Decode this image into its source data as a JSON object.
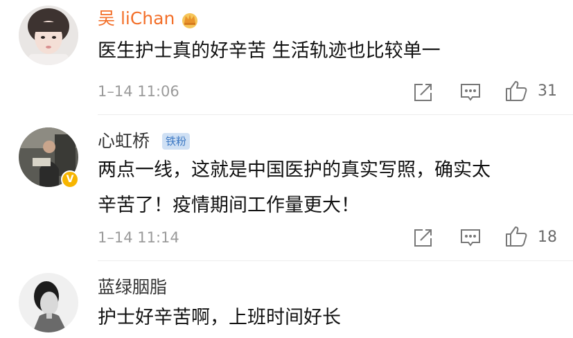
{
  "comments": [
    {
      "username": "吴 liChan",
      "text_lines": [
        "医生护士真的好辛苦 生活轨迹也比较单一"
      ],
      "time": "1–14 11:06",
      "likes": "31",
      "has_crown": true
    },
    {
      "username": "心虹桥",
      "badge": "铁粉",
      "verified_mark": "V",
      "text_lines": [
        "两点一线，这就是中国医护的真实写照，确实太",
        "辛苦了！疫情期间工作量更大！"
      ],
      "time": "1–14 11:14",
      "likes": "18"
    },
    {
      "username": "蓝绿胭脂",
      "text_lines": [
        "护士好辛苦啊，上班时间好长"
      ]
    }
  ],
  "icons": {
    "share": "share-icon",
    "reply": "comment-icon",
    "like": "thumbs-up-icon",
    "crown": "crown-icon",
    "verified": "verified-icon"
  },
  "colors": {
    "vip_username": "#f36f29",
    "username": "#333333",
    "timestamp": "#9a9a9a",
    "badge_bg": "#cfe0f4",
    "badge_text": "#3c78c3",
    "verified": "#f7b500"
  }
}
